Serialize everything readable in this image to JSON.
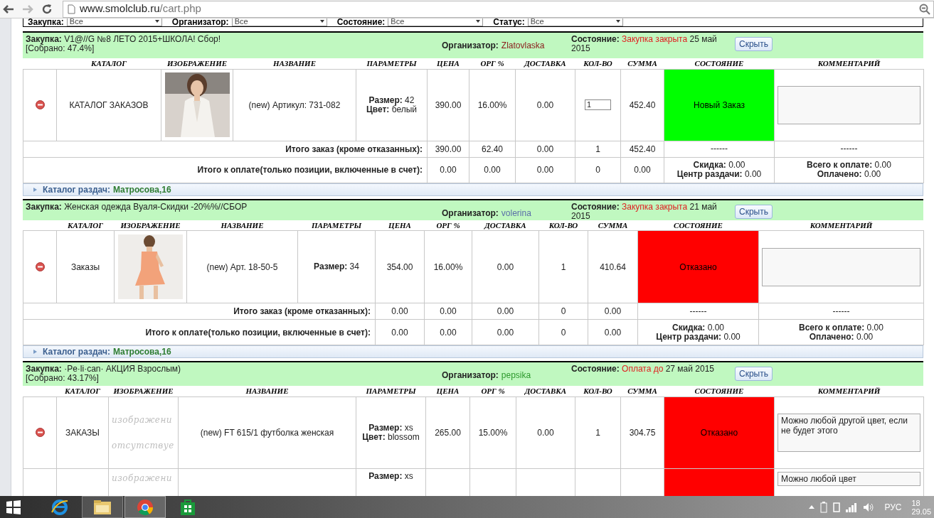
{
  "browser": {
    "url_host": "www.smolclub.ru",
    "url_path": "/cart.php"
  },
  "filters": [
    {
      "label": "Закупка:",
      "value": "Все"
    },
    {
      "label": "Организатор:",
      "value": "Все"
    },
    {
      "label": "Состояние:",
      "value": "Все"
    },
    {
      "label": "Статус:",
      "value": "Все"
    }
  ],
  "purchases": [
    {
      "title": "**Закупка:** V1@//G №8 ЛЕТО 2015+ШКОЛА! Сбор!",
      "collected": "[Собрано: 47.4%]",
      "organizer_label": "Организатор:",
      "organizer": "Zlatovlaska",
      "color": "#8b1a1a",
      "state_label": "Состояние:",
      "state": "Закупка закрыта",
      "state_date": "25 май 2015",
      "hide_button": "Скрыть",
      "columns": [
        "КАТАЛОГ",
        "ИЗОБРАЖЕНИЕ",
        "НАЗВАНИЕ",
        "ПАРАМЕТРЫ",
        "ЦЕНА",
        "ОРГ %",
        "ДОСТАВКА",
        "КОЛ-ВО",
        "СУММА",
        "СОСТОЯНИЕ",
        "КОММЕНТАРИЙ"
      ],
      "items": [
        {
          "catalog": "КАТАЛОГ ЗАКАЗОВ",
          "image": {
            "kind": "picture"
          },
          "name": "(new) Артикул: 731-082",
          "params": [
            "**Размер:** 42",
            "**Цвет:** белый"
          ],
          "price": "390.00",
          "org": "16.00%",
          "delivery": "0.00",
          "qty": "1",
          "qty_input": true,
          "sum": "452.40",
          "status": "Новый Заказ",
          "color": "#00ff00"
        }
      ],
      "totals": [
        {
          "label": "Итого заказ (кроме отказанных):",
          "price": "390.00",
          "org": "62.40",
          "delivery": "0.00",
          "qty": "1",
          "sum": "452.40",
          "state": [
            "------"
          ],
          "comment": [
            "------"
          ]
        },
        {
          "label": "Итого к оплате(только позиции, включенные в счет):",
          "price": "0.00",
          "org": "0.00",
          "delivery": "0.00",
          "qty": "0",
          "sum": "0.00",
          "state": [
            "**Скидка:** 0.00",
            "**Центр раздачи:** 0.00"
          ],
          "comment": [
            "**Всего к оплате:** 0.00",
            "**Оплачено:** 0.00"
          ]
        }
      ],
      "pickup": {
        "label": "Каталог раздач:",
        "value": "Матросова,16"
      }
    },
    {
      "title": "**Закупка:** Женская одежда Вуаля-Скидки -20%%//СБОР",
      "organizer_label": "Организатор:",
      "organizer": "volerina",
      "color": "#5a6fa8",
      "state_label": "Состояние:",
      "state": "Закупка закрыта",
      "state_date": "21 май 2015",
      "hide_button": "Скрыть",
      "columns": [
        "КАТАЛОГ",
        "ИЗОБРАЖЕНИЕ",
        "НАЗВАНИЕ",
        "ПАРАМЕТРЫ",
        "ЦЕНА",
        "ОРГ %",
        "ДОСТАВКА",
        "КОЛ-ВО",
        "СУММА",
        "СОСТОЯНИЕ",
        "КОММЕНТАРИЙ"
      ],
      "items": [
        {
          "catalog": "Заказы",
          "image": {
            "kind": "picture"
          },
          "name": "(new) Арт. 18-50-5",
          "params": [
            "**Размер:** 34"
          ],
          "price": "354.00",
          "org": "16.00%",
          "delivery": "0.00",
          "qty": "1",
          "qty_input": false,
          "sum": "410.64",
          "status": "Отказано",
          "color": "#ff0000"
        }
      ],
      "totals": [
        {
          "label": "Итого заказ (кроме отказанных):",
          "price": "0.00",
          "org": "0.00",
          "delivery": "0.00",
          "qty": "0",
          "sum": "0.00",
          "state": [
            "------"
          ],
          "comment": [
            "------"
          ]
        },
        {
          "label": "Итого к оплате(только позиции, включенные в счет):",
          "price": "0.00",
          "org": "0.00",
          "delivery": "0.00",
          "qty": "0",
          "sum": "0.00",
          "state": [
            "**Скидка:** 0.00",
            "**Центр раздачи:** 0.00"
          ],
          "comment": [
            "**Всего к оплате:** 0.00",
            "**Оплачено:** 0.00"
          ]
        }
      ],
      "pickup": {
        "label": "Каталог раздач:",
        "value": "Матросова,16"
      }
    },
    {
      "title": "**Закупка:** ·Pe·li·can· АКЦИЯ Взрослым)",
      "collected": "[Собрано: 43.17%]",
      "organizer_label": "Организатор:",
      "organizer": "pepsika",
      "color": "#2e9a2e",
      "state_label": "Состояние:",
      "state": "Оплата до",
      "state_date": "27 май 2015",
      "hide_button": "Скрыть",
      "columns": [
        "КАТАЛОГ",
        "ИЗОБРАЖЕНИЕ",
        "НАЗВАНИЕ",
        "ПАРАМЕТРЫ",
        "ЦЕНА",
        "ОРГ %",
        "ДОСТАВКА",
        "КОЛ-ВО",
        "СУММА",
        "СОСТОЯНИЕ",
        "КОММЕНТАРИЙ"
      ],
      "items": [
        {
          "catalog": "ЗАКАЗЫ",
          "image": {
            "kind": "missing",
            "lines": [
              "изображени",
              "отсутствуе"
            ]
          },
          "name": "(new) FT 615/1 футболка женская",
          "params": [
            "**Размер:** xs",
            "**Цвет:** blossom"
          ],
          "price": "265.00",
          "org": "15.00%",
          "delivery": "0.00",
          "qty": "1",
          "qty_input": false,
          "sum": "304.75",
          "status": "Отказано",
          "color": "#ff0000",
          "comment": "Можно любой другой цвет, если не будет этого"
        },
        {
          "image": {
            "kind": "missing",
            "lines": [
              "изображени"
            ]
          },
          "params": [
            "**Размер:** xs"
          ],
          "color": "#ff0000",
          "comment": "Можно любой цвет"
        }
      ]
    }
  ],
  "taskbar": {
    "language": "РУС",
    "time": "18",
    "date": "29.05"
  }
}
